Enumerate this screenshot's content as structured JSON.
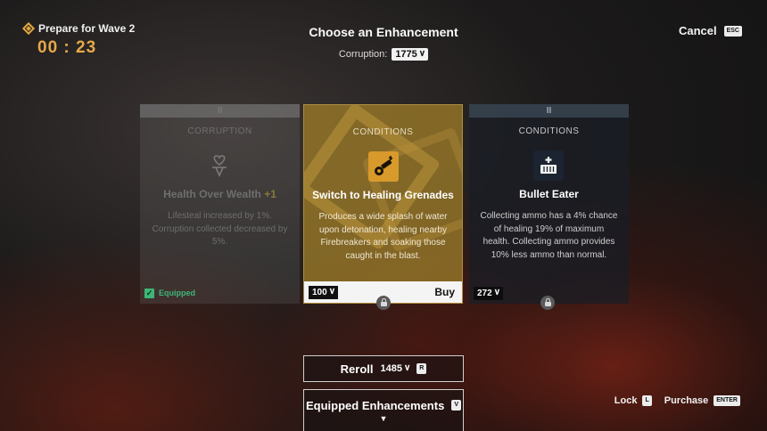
{
  "wave": {
    "label": "Prepare for Wave 2",
    "timer": "00 : 23"
  },
  "header": {
    "title": "Choose an Enhancement",
    "corruption_label": "Corruption:",
    "corruption_value": "1775"
  },
  "cancel": {
    "label": "Cancel",
    "key": "ESC"
  },
  "currency_icon": "V-mark-icon",
  "cards": [
    {
      "tag": "II",
      "category": "CORRUPTION",
      "icon": "heart-drain-icon",
      "name": "Health Over Wealth",
      "name_suffix": "+1",
      "description": "Lifesteal increased by 1%. Corruption collected decreased by 5%.",
      "status": "Equipped"
    },
    {
      "category": "CONDITIONS",
      "icon": "grenade-launcher-icon",
      "name": "Switch to Healing Grenades",
      "description": "Produces a wide splash of water upon detonation, healing nearby Firebreakers and soaking those caught in the blast.",
      "price": "100",
      "action": "Buy"
    },
    {
      "tag": "II",
      "category": "CONDITIONS",
      "icon": "ammo-box-plus-icon",
      "name": "Bullet Eater",
      "description": "Collecting ammo has a 4% chance of healing 19% of maximum health. Collecting ammo provides 10% less ammo than normal.",
      "price": "272"
    }
  ],
  "reroll": {
    "label": "Reroll",
    "cost": "1485",
    "key": "R"
  },
  "equipped_enhancements": {
    "label": "Equipped Enhancements",
    "key": "V"
  },
  "controls": {
    "lock_label": "Lock",
    "lock_key": "L",
    "purchase_label": "Purchase",
    "purchase_key": "ENTER"
  },
  "colors": {
    "accent_gold": "#e7a94a",
    "selected_card": "#96762a",
    "equipped_green": "#3db577"
  }
}
